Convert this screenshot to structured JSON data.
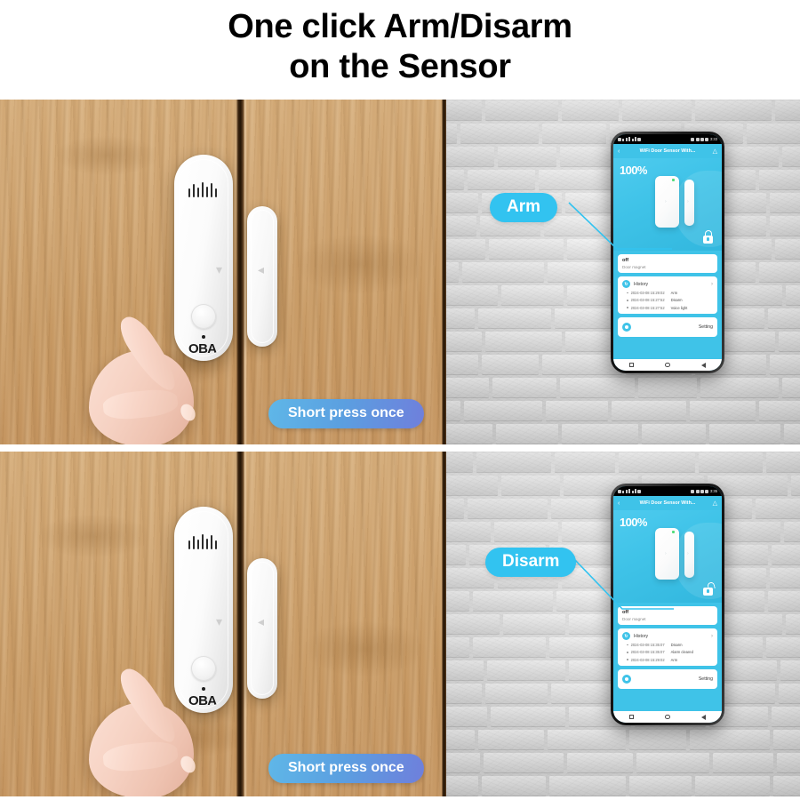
{
  "title": {
    "line1": "One click Arm/Disarm",
    "line2": "on the Sensor"
  },
  "colors": {
    "accent_cyan": "#32c3f0",
    "app_cyan": "#3fc3e8",
    "press_button_start": "#5fb7e8",
    "press_button_end": "#6f7fdc",
    "wood": "#cfa470",
    "brick": "#dcdcdc",
    "led_green": "#52dc7a"
  },
  "sensor": {
    "brand_logo": "OBA",
    "button_name": "power-button",
    "led_name": "status-led"
  },
  "panels": [
    {
      "id": "arm",
      "callout": {
        "label": "Arm",
        "icon": "leader-line"
      },
      "press_label": "Short press once",
      "phone": {
        "status_bar": {
          "time": "3:33"
        },
        "header": {
          "title": "WiFi Door Sensor With...",
          "back_icon": "chevron-left-icon",
          "share_icon": "share-icon"
        },
        "hero": {
          "battery": "100%",
          "lock_state": "locked",
          "lock_icon": "lock-closed-icon",
          "device_illustration": "door-sensor-illustration"
        },
        "state_card": {
          "state": "off",
          "subtitle": "Door magnet"
        },
        "history": {
          "label": "History",
          "icon": "history-icon",
          "chevron": "chevron-right-icon",
          "entries": [
            {
              "time": "2024-03-08 15:29:02",
              "event": "Arm"
            },
            {
              "time": "2024-03-08 15:27:52",
              "event": "Disarm"
            },
            {
              "time": "2024-03-08 15:27:52",
              "event": "Voice light"
            }
          ]
        },
        "setting": {
          "label": "Setting",
          "icon": "gear-icon"
        },
        "navbar": {
          "recent": "square-icon",
          "home": "circle-icon",
          "back": "triangle-back-icon"
        }
      }
    },
    {
      "id": "disarm",
      "callout": {
        "label": "Disarm",
        "icon": "leader-line"
      },
      "press_label": "Short press once",
      "phone": {
        "status_bar": {
          "time": "3:35"
        },
        "header": {
          "title": "WiFi Door Sensor With...",
          "back_icon": "chevron-left-icon",
          "share_icon": "share-icon"
        },
        "hero": {
          "battery": "100%",
          "lock_state": "unlocked",
          "lock_icon": "lock-open-icon",
          "device_illustration": "door-sensor-illustration"
        },
        "state_card": {
          "state": "off",
          "subtitle": "Door magnet"
        },
        "history": {
          "label": "History",
          "icon": "history-icon",
          "chevron": "chevron-right-icon",
          "entries": [
            {
              "time": "2024-03-08 15:35:07",
              "event": "Disarm"
            },
            {
              "time": "2024-03-08 15:35:07",
              "event": "Alarm cleared"
            },
            {
              "time": "2024-03-08 15:29:02",
              "event": "Arm"
            }
          ]
        },
        "setting": {
          "label": "Setting",
          "icon": "gear-icon"
        },
        "navbar": {
          "recent": "square-icon",
          "home": "circle-icon",
          "back": "triangle-back-icon"
        }
      }
    }
  ]
}
